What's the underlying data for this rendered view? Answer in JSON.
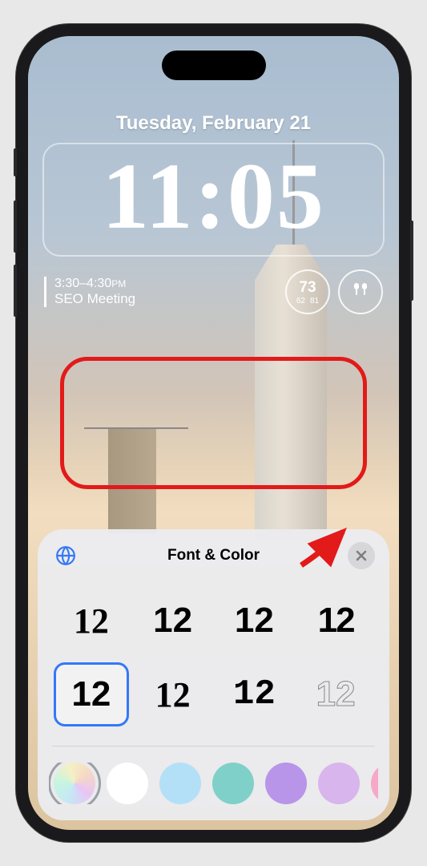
{
  "lockscreen": {
    "date": "Tuesday, February 21",
    "time": "11:05",
    "widgets": {
      "meeting": {
        "time": "3:30–4:30",
        "ampm": "PM",
        "title": "SEO Meeting"
      },
      "weather": {
        "temp": "73",
        "low": "62",
        "high": "81"
      }
    }
  },
  "panel": {
    "title": "Font & Color",
    "font_sample": "12",
    "selected_font_index": 4,
    "colors": [
      {
        "value": "gradient",
        "selected": true
      },
      {
        "value": "#ffffff"
      },
      {
        "value": "#b3e0f7"
      },
      {
        "value": "#7fd0c9"
      },
      {
        "value": "#b895e8"
      },
      {
        "value": "#d8b5ec"
      },
      {
        "value": "#f5a8c8"
      }
    ]
  }
}
